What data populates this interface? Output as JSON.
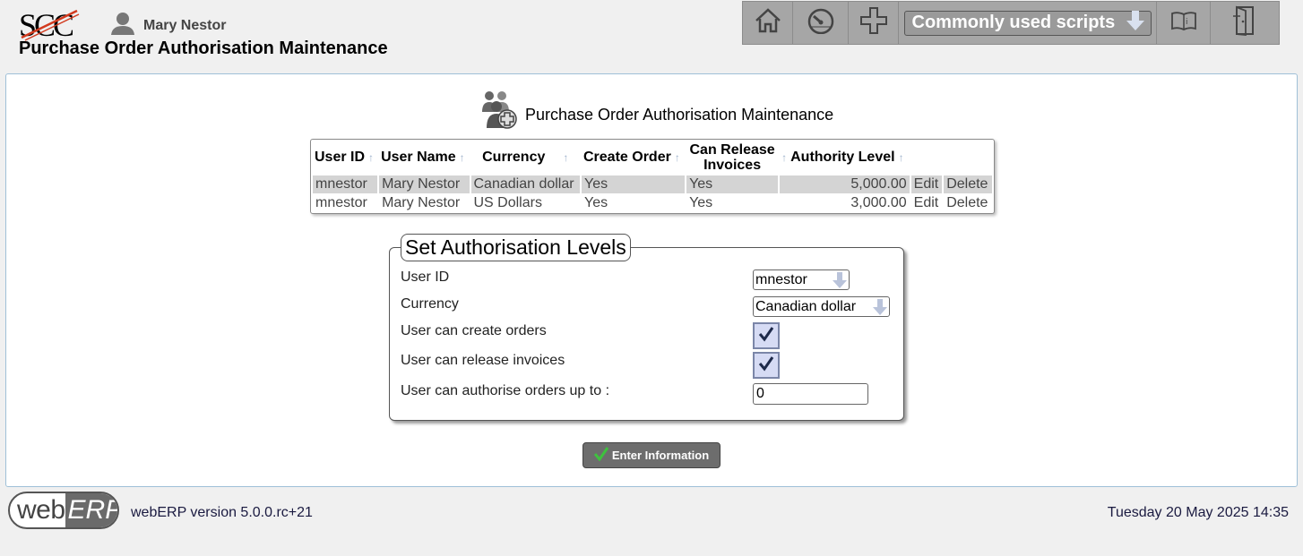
{
  "header": {
    "logo_text": "SCC",
    "user_name": "Mary Nestor",
    "page_heading": "Purchase Order Authorisation Maintenance"
  },
  "toolbar": {
    "home_icon": "home-icon",
    "dashboard_icon": "dashboard-gauge-icon",
    "add_icon": "plus-icon",
    "scripts_label": "Commonly used scripts",
    "manual_icon": "manual-book-icon",
    "logout_icon": "logout-door-icon"
  },
  "main": {
    "title": "Purchase Order Authorisation Maintenance",
    "table": {
      "headers": [
        "User ID",
        "User Name",
        "Currency",
        "Create Order",
        "Can Release Invoices",
        "Authority Level"
      ],
      "header_release_line1": "Can Release",
      "header_release_line2": "Invoices",
      "rows": [
        {
          "user_id": "mnestor",
          "user_name": "Mary Nestor",
          "currency": "Canadian dollar",
          "create_order": "Yes",
          "can_release": "Yes",
          "authority_level": "5,000.00",
          "edit": "Edit",
          "delete": "Delete"
        },
        {
          "user_id": "mnestor",
          "user_name": "Mary Nestor",
          "currency": "US Dollars",
          "create_order": "Yes",
          "can_release": "Yes",
          "authority_level": "3,000.00",
          "edit": "Edit",
          "delete": "Delete"
        }
      ]
    },
    "form": {
      "legend": "Set Authorisation Levels",
      "user_id_label": "User ID",
      "user_id_value": "mnestor",
      "currency_label": "Currency",
      "currency_value": "Canadian dollar",
      "create_label": "User can create orders",
      "create_checked": true,
      "release_label": "User can release invoices",
      "release_checked": true,
      "authorise_label": "User can authorise orders up to :",
      "authorise_value": "0",
      "submit_label": "Enter Information"
    }
  },
  "footer": {
    "logo_web": "web",
    "logo_erp": "ERP",
    "version": "webERP version 5.0.0.rc+21",
    "datetime": "Tuesday 20 May 2025 14:35"
  }
}
